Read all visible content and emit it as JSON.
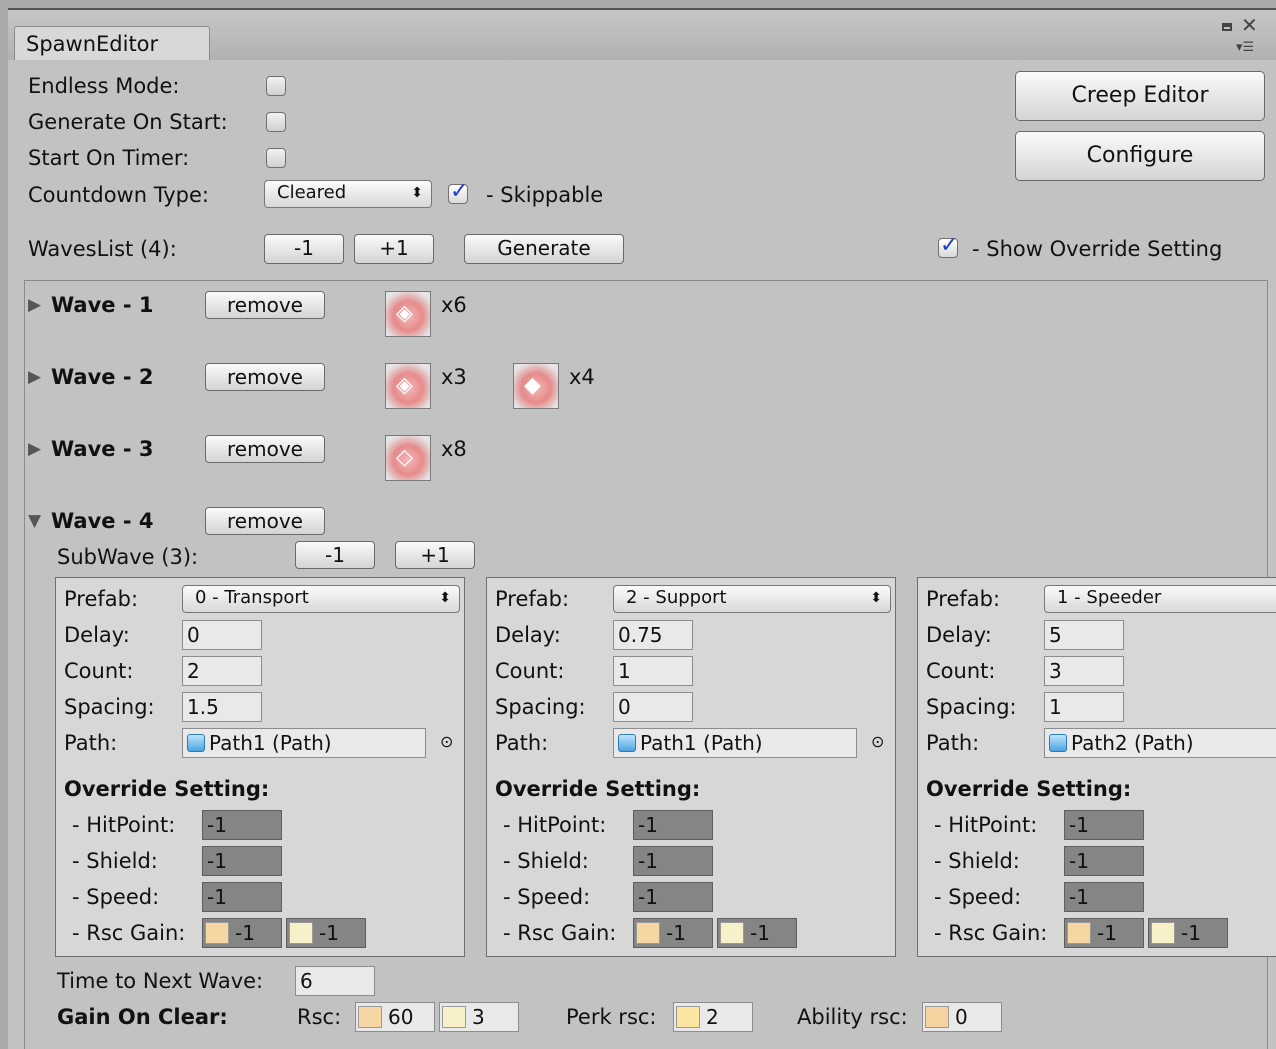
{
  "window": {
    "tab_title": "SpawnEditor",
    "window_controls": [
      "minimize-icon",
      "close-icon",
      "menu-icon"
    ]
  },
  "settings": {
    "endless_mode_label": "Endless Mode:",
    "endless_mode_checked": false,
    "generate_on_start_label": "Generate On Start:",
    "generate_on_start_checked": false,
    "start_on_timer_label": "Start On Timer:",
    "start_on_timer_checked": false,
    "countdown_type_label": "Countdown Type:",
    "countdown_type_value": "Cleared",
    "skippable_checked": true,
    "skippable_label": "- Skippable"
  },
  "buttons": {
    "creep_editor": "Creep Editor",
    "configure": "Configure"
  },
  "waves_list": {
    "label": "WavesList (4):",
    "minus": "-1",
    "plus": "+1",
    "generate": "Generate",
    "show_override_checked": true,
    "show_override_label": "- Show Override Setting"
  },
  "waves": [
    {
      "title": "Wave - 1",
      "remove": "remove",
      "creeps": [
        {
          "icon": "transport-creep-icon",
          "count": "x6"
        }
      ]
    },
    {
      "title": "Wave - 2",
      "remove": "remove",
      "creeps": [
        {
          "icon": "transport-creep-icon",
          "count": "x3"
        },
        {
          "icon": "speeder-creep-icon",
          "count": "x4"
        }
      ]
    },
    {
      "title": "Wave - 3",
      "remove": "remove",
      "creeps": [
        {
          "icon": "support-creep-icon",
          "count": "x8"
        }
      ]
    },
    {
      "title": "Wave - 4",
      "remove": "remove",
      "expanded": true
    }
  ],
  "wave4": {
    "subwave_label": "SubWave (3):",
    "minus": "-1",
    "plus": "+1",
    "subwaves": [
      {
        "prefab_label": "Prefab:",
        "prefab": "0 - Transport",
        "delay_label": "Delay:",
        "delay": "0",
        "count_label": "Count:",
        "count": "2",
        "spacing_label": "Spacing:",
        "spacing": "1.5",
        "path_label": "Path:",
        "path": "Path1 (Path)",
        "override_title": "Override Setting:",
        "hitpoint_label": "- HitPoint:",
        "hitpoint": "-1",
        "shield_label": "- Shield:",
        "shield": "-1",
        "speed_label": "- Speed:",
        "speed": "-1",
        "rsc_label": "- Rsc Gain:",
        "rsc1": "-1",
        "rsc2": "-1"
      },
      {
        "prefab_label": "Prefab:",
        "prefab": "2 - Support",
        "delay_label": "Delay:",
        "delay": "0.75",
        "count_label": "Count:",
        "count": "1",
        "spacing_label": "Spacing:",
        "spacing": "0",
        "path_label": "Path:",
        "path": "Path1 (Path)",
        "override_title": "Override Setting:",
        "hitpoint_label": "- HitPoint:",
        "hitpoint": "-1",
        "shield_label": "- Shield:",
        "shield": "-1",
        "speed_label": "- Speed:",
        "speed": "-1",
        "rsc_label": "- Rsc Gain:",
        "rsc1": "-1",
        "rsc2": "-1"
      },
      {
        "prefab_label": "Prefab:",
        "prefab": "1 - Speeder",
        "delay_label": "Delay:",
        "delay": "5",
        "count_label": "Count:",
        "count": "3",
        "spacing_label": "Spacing:",
        "spacing": "1",
        "path_label": "Path:",
        "path": "Path2 (Path)",
        "override_title": "Override Setting:",
        "hitpoint_label": "- HitPoint:",
        "hitpoint": "-1",
        "shield_label": "- Shield:",
        "shield": "-1",
        "speed_label": "- Speed:",
        "speed": "-1",
        "rsc_label": "- Rsc Gain:",
        "rsc1": "-1",
        "rsc2": "-1"
      }
    ],
    "time_to_next_label": "Time to Next Wave:",
    "time_to_next": "6",
    "gain_label": "Gain On Clear:",
    "rsc_label": "Rsc:",
    "rsc1": "60",
    "rsc2": "3",
    "perk_label": "Perk rsc:",
    "perk": "2",
    "ability_label": "Ability rsc:",
    "ability": "0"
  }
}
